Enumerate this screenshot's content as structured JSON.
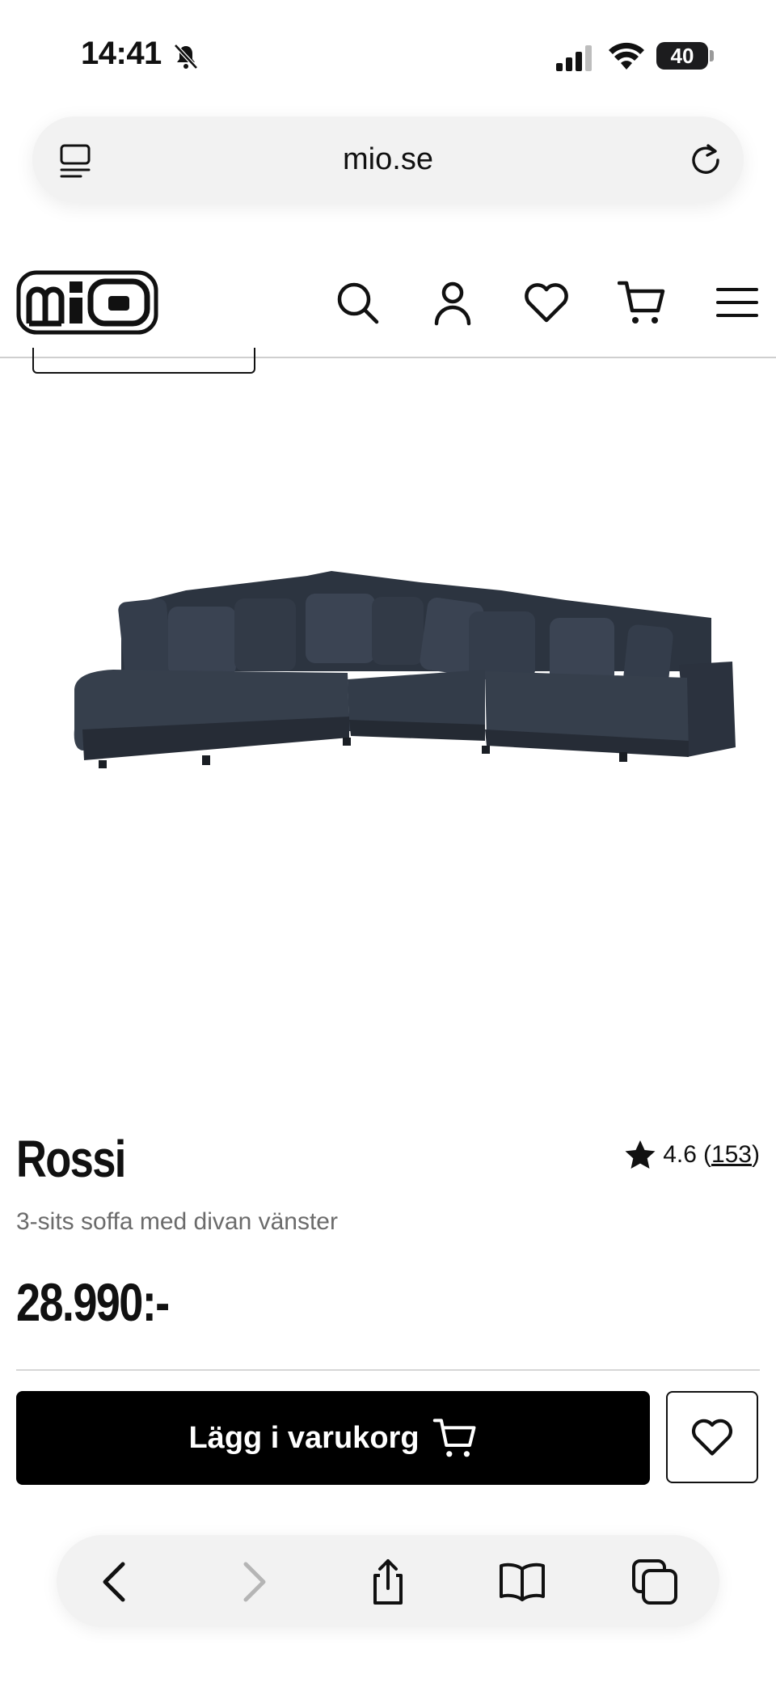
{
  "status_bar": {
    "time": "14:41",
    "battery": "40"
  },
  "browser": {
    "url": "mio.se"
  },
  "header": {
    "brand": "mio"
  },
  "product": {
    "name": "Rossi",
    "rating": "4.6",
    "review_count": "153",
    "description": "3-sits soffa med divan vänster",
    "price": "28.990:-"
  },
  "actions": {
    "add_to_cart_label": "Lägg i varukorg"
  },
  "colors": {
    "accent": "#000000",
    "sofa": "#2f3845",
    "muted_text": "#6b6b6b"
  }
}
